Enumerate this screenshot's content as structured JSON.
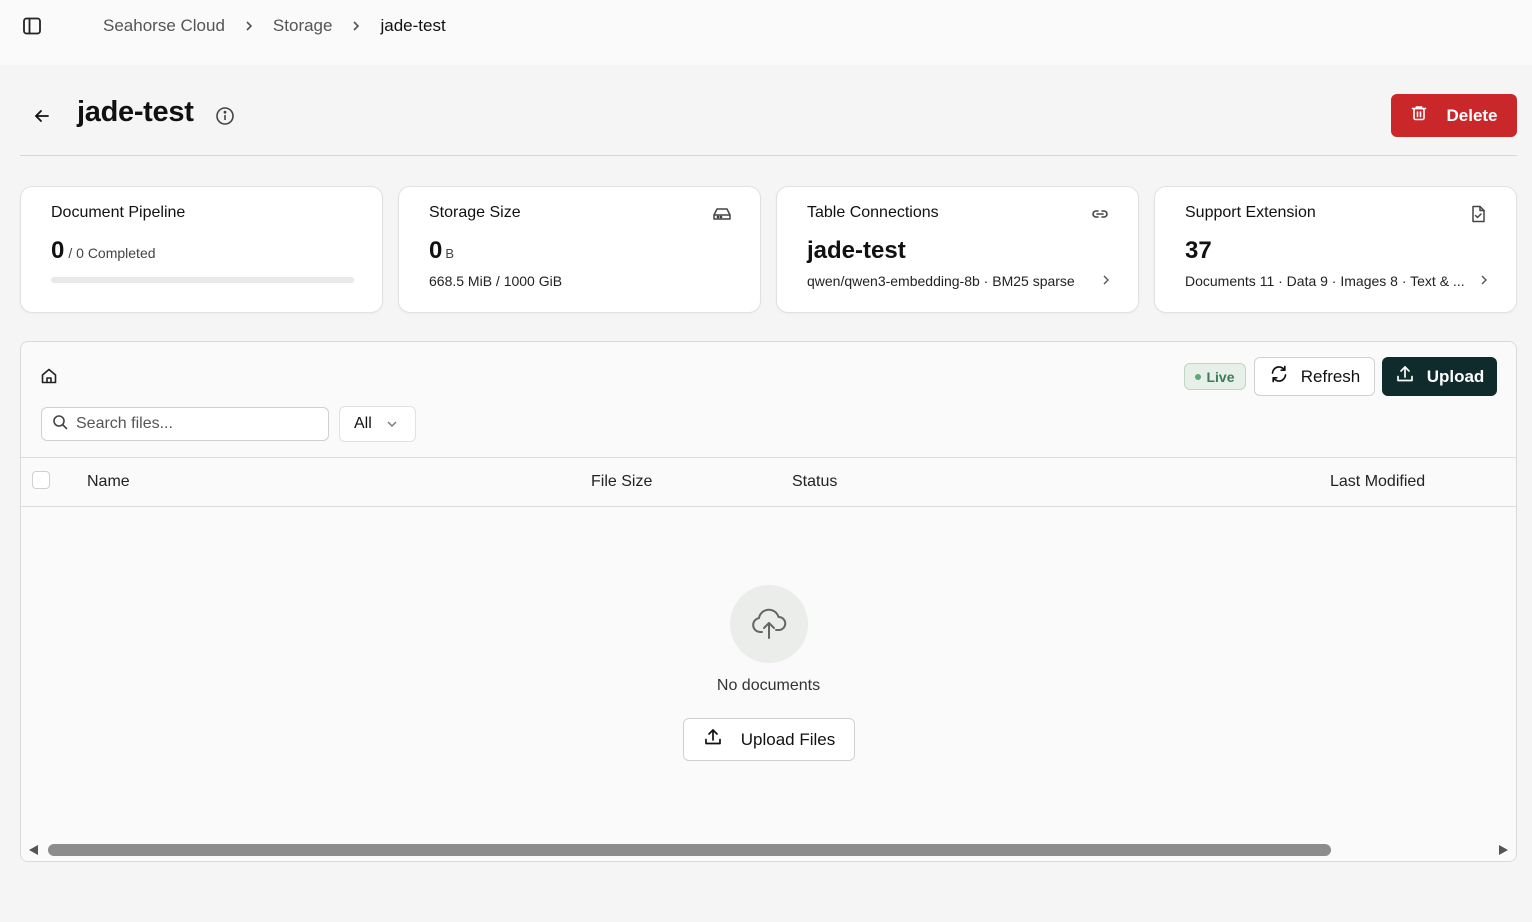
{
  "breadcrumb": {
    "items": [
      "Seahorse Cloud",
      "Storage",
      "jade-test"
    ]
  },
  "header": {
    "title": "jade-test",
    "delete_label": "Delete"
  },
  "cards": {
    "pipeline": {
      "title": "Document Pipeline",
      "value": "0",
      "suffix": "/ 0 Completed",
      "progress_fraction": 0
    },
    "storage": {
      "title": "Storage Size",
      "value": "0",
      "unit": "B",
      "sub": "668.5 MiB / 1000 GiB"
    },
    "table": {
      "title": "Table Connections",
      "value": "jade-test",
      "sub": "qwen/qwen3-embedding-8b · BM25 sparse"
    },
    "extension": {
      "title": "Support Extension",
      "value": "37",
      "sub": "Documents 11 · Data 9 · Images 8 · Text & ..."
    }
  },
  "files": {
    "live_label": "Live",
    "refresh_label": "Refresh",
    "upload_label": "Upload",
    "search_placeholder": "Search files...",
    "filter_value": "All",
    "columns": {
      "name": "Name",
      "size": "File Size",
      "status": "Status",
      "modified": "Last Modified"
    },
    "empty_text": "No documents",
    "upload_files_label": "Upload Files"
  },
  "colors": {
    "danger": "#c9272a",
    "primary_dark": "#0f2b2b",
    "live_green": "#3e7b55"
  }
}
